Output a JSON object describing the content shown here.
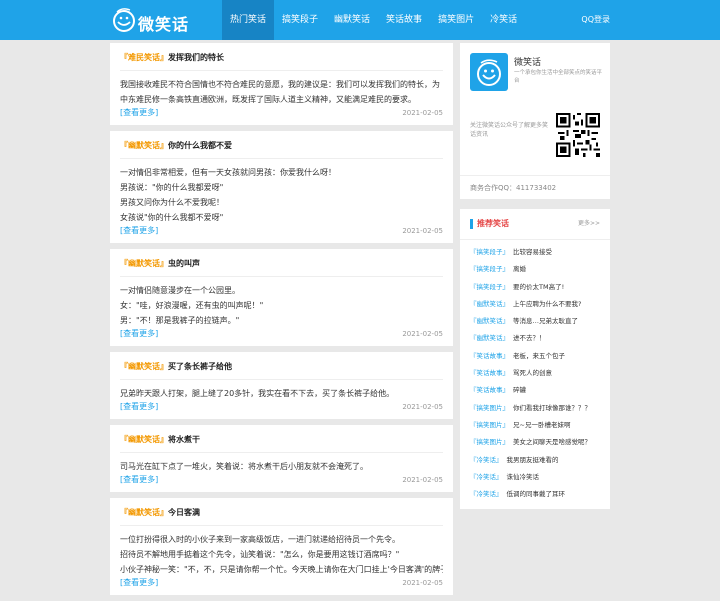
{
  "header": {
    "logo_text": "微笑话",
    "nav": [
      {
        "label": "热门笑话",
        "active": true
      },
      {
        "label": "搞笑段子",
        "active": false
      },
      {
        "label": "幽默笑话",
        "active": false
      },
      {
        "label": "笑话故事",
        "active": false
      },
      {
        "label": "搞笑图片",
        "active": false
      },
      {
        "label": "冷笑话",
        "active": false
      }
    ],
    "login": "QQ登录"
  },
  "posts": [
    {
      "category": "『难民笑话』",
      "title": "发挥我们的特长",
      "body": [
        "我国接收难民不符合国情也不符合难民的意愿，我的建议是：我们可以发挥我们的特长，为",
        "中东难民修一条高铁直通欧洲，既发挥了国际人道主义精神，又能满足难民的要求。"
      ],
      "more": "[查看更多]",
      "date": "2021-02-05"
    },
    {
      "category": "『幽默笑话』",
      "title": "你的什么我都不爱",
      "body": [
        "一对情侣非常相爱，但有一天女孩就问男孩：你爱我什么呀！",
        "男孩说：\"你的什么我都爱呀\"",
        "男孩又问你为什么不爱我呢！",
        "女孩说\"你的什么我都不爱呀\""
      ],
      "more": "[查看更多]",
      "date": "2021-02-05"
    },
    {
      "category": "『幽默笑话』",
      "title": "虫的叫声",
      "body": [
        "一对情侣随意漫步在一个公园里。",
        "女：\"哇，好浪漫喔，还有虫的叫声呢！\"",
        "男：\"不！那是我裤子的拉链声。\""
      ],
      "more": "[查看更多]",
      "date": "2021-02-05"
    },
    {
      "category": "『幽默笑话』",
      "title": "买了条长裤子给他",
      "body": [
        "兄弟昨天跟人打架，腿上缝了20多针，我实在看不下去，买了条长裤子给他。"
      ],
      "more": "[查看更多]",
      "date": "2021-02-05"
    },
    {
      "category": "『幽默笑话』",
      "title": "将水煮干",
      "body": [
        "司马光在缸下点了一堆火，笑着说：将水煮干后小朋友就不会淹死了。"
      ],
      "more": "[查看更多]",
      "date": "2021-02-05"
    },
    {
      "category": "『幽默笑话』",
      "title": "今日客满",
      "body": [
        "一位打扮得很入时的小伙子来到一家高级饭店，一进门就递给招待员一个先令。",
        "招待员不解地用手掂着这个先令，讪笑着说：\"怎么，你是要用这钱订酒席吗？\"",
        "小伙子神秘一笑：\"不，不，只是请你帮一个忙。今天晚上请你在大门口挂上'今日客满'的牌子。\""
      ],
      "more": "[查看更多]",
      "date": "2021-02-05"
    }
  ],
  "sidebar": {
    "brand_name": "微笑话",
    "brand_desc": "一个承包你生活中全部笑点的笑话平台",
    "follow_text": "关注微笑话公众号了解更多笑话资讯",
    "business": "商务合作QQ：411733402",
    "rec_title": "推荐笑话",
    "rec_more": "更多>>",
    "rec_items": [
      {
        "cat": "『搞笑段子』",
        "title": "比较容易接受"
      },
      {
        "cat": "『搞笑段子』",
        "title": "离婚"
      },
      {
        "cat": "『搞笑段子』",
        "title": "要的价太TM高了!"
      },
      {
        "cat": "『幽默笑话』",
        "title": "上午应聘为什么不要我?"
      },
      {
        "cat": "『幽默笑话』",
        "title": "等消息…兄弟太耿直了"
      },
      {
        "cat": "『幽默笑话』",
        "title": "进不去？！"
      },
      {
        "cat": "『笑话故事』",
        "title": "老板，来五个包子"
      },
      {
        "cat": "『笑话故事』",
        "title": "骂死人的创意"
      },
      {
        "cat": "『笑话故事』",
        "title": "碎罐"
      },
      {
        "cat": "『搞笑图片』",
        "title": "你们看我打球像那谁？？？"
      },
      {
        "cat": "『搞笑图片』",
        "title": "兄~兄一卧槽老妹啊"
      },
      {
        "cat": "『搞笑图片』",
        "title": "美女之间聊天是啥感觉呢？"
      },
      {
        "cat": "『冷笑话』",
        "title": "我男朋友挺难看的"
      },
      {
        "cat": "『冷笑话』",
        "title": "诛仙冷笑话"
      },
      {
        "cat": "『冷笑话』",
        "title": "低调的同事戴了耳环"
      }
    ]
  }
}
